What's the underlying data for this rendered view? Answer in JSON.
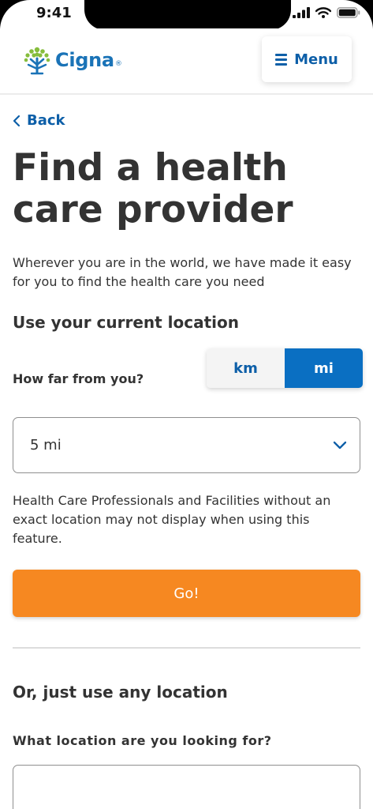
{
  "status_bar": {
    "time": "9:41"
  },
  "header": {
    "logo_text": "Cigna",
    "logo_mark": "®",
    "menu_label": "Menu",
    "brand_color": "#1a73b7",
    "icons": {
      "logo": "tree-of-life-logo",
      "menu": "hamburger-icon"
    }
  },
  "nav": {
    "back_label": "Back",
    "back_icon": "chevron-left-icon"
  },
  "page": {
    "title": "Find a health care provider",
    "intro": "Wherever you are in the world, we have made it easy for you to find the health care you need"
  },
  "current_location": {
    "heading": "Use your current location",
    "distance_label": "How far from you?",
    "units": [
      {
        "label": "km",
        "selected": false
      },
      {
        "label": "mi",
        "selected": true
      }
    ],
    "distance_value": "5 mi",
    "dropdown_icon": "chevron-down-icon",
    "note": "Health Care Professionals and Facilities without an exact location may not display when using this feature.",
    "go_label": "Go!",
    "go_color": "#f68821"
  },
  "any_location": {
    "heading": "Or, just use any location",
    "field_label": "What location are you looking for?",
    "input_value": ""
  }
}
